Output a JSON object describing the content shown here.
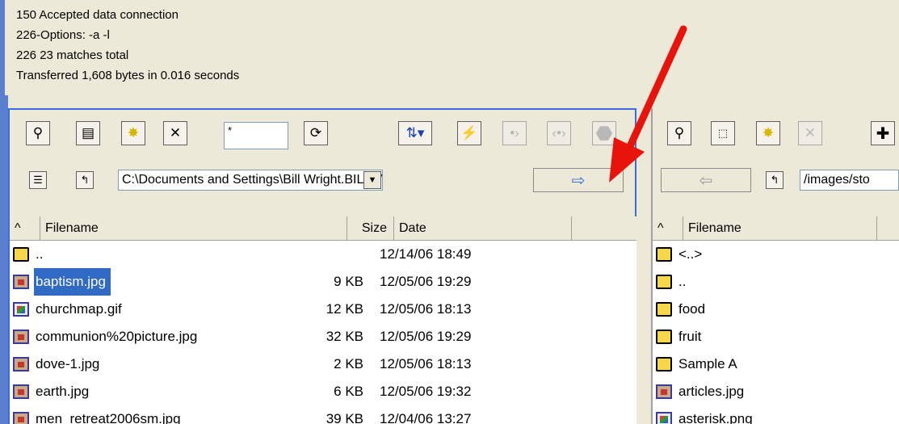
{
  "log": {
    "lines": [
      "150 Accepted data connection",
      "226-Options: -a -l",
      "226 23 matches total",
      "Transferred 1,608 bytes in 0.016 seconds"
    ]
  },
  "left": {
    "filter_value": "*",
    "path": "C:\\Documents and Settings\\Bill Wright.BILLWRI",
    "columns": {
      "sort": "^",
      "filename": "Filename",
      "size": "Size",
      "date": "Date"
    },
    "rows": [
      {
        "name": "..",
        "size": "",
        "date": "12/14/06 18:49",
        "icon": "folder-icon"
      },
      {
        "name": "baptism.jpg",
        "size": "9 KB",
        "date": "12/05/06 19:29",
        "icon": "jpg-file-icon"
      },
      {
        "name": "churchmap.gif",
        "size": "12 KB",
        "date": "12/05/06 18:13",
        "icon": "gif-file-icon"
      },
      {
        "name": "communion%20picture.jpg",
        "size": "32 KB",
        "date": "12/05/06 19:29",
        "icon": "jpg-file-icon"
      },
      {
        "name": "dove-1.jpg",
        "size": "2 KB",
        "date": "12/05/06 18:13",
        "icon": "jpg-file-icon"
      },
      {
        "name": "earth.jpg",
        "size": "6 KB",
        "date": "12/05/06 19:32",
        "icon": "jpg-file-icon"
      },
      {
        "name": "men_retreat2006sm.jpg",
        "size": "39 KB",
        "date": "12/04/06 13:27",
        "icon": "jpg-file-icon"
      }
    ]
  },
  "right": {
    "path": "/images/sto",
    "columns": {
      "sort": "^",
      "filename": "Filename"
    },
    "rows": [
      {
        "name": "<..>",
        "icon": "folder-icon"
      },
      {
        "name": "..",
        "icon": "folder-icon"
      },
      {
        "name": "food",
        "icon": "folder-icon"
      },
      {
        "name": "fruit",
        "icon": "folder-icon"
      },
      {
        "name": "Sample A",
        "icon": "folder-icon"
      },
      {
        "name": "articles.jpg",
        "icon": "jpg-file-icon"
      },
      {
        "name": "asterisk.png",
        "icon": "gif-file-icon"
      }
    ]
  },
  "colors": {
    "selection": "#316ac5",
    "pane_border": "#3a6fd8",
    "annotation_arrow": "#e8140c"
  }
}
